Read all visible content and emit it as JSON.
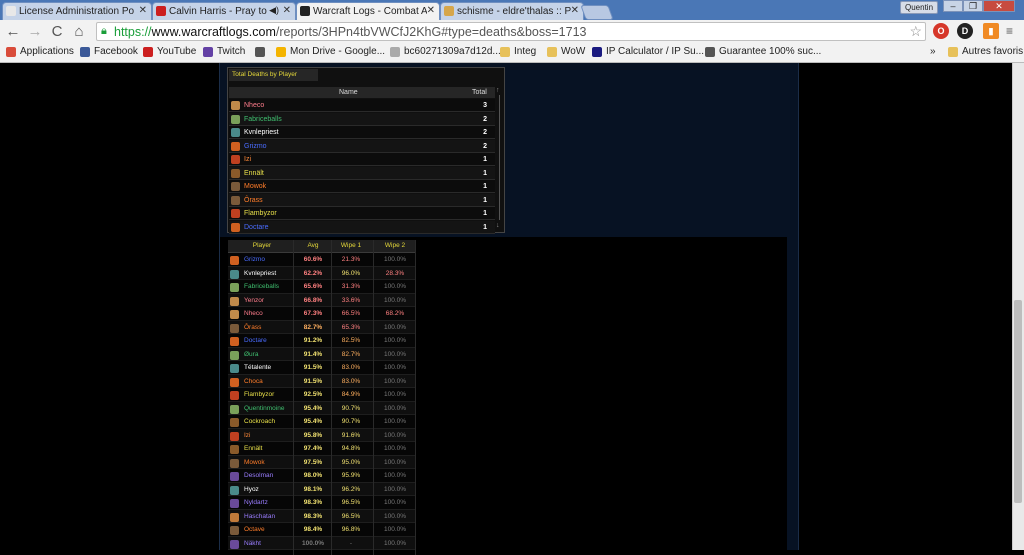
{
  "browser": {
    "tabs": [
      {
        "label": "License Administration Po",
        "favicon_color": "#e8e8e8",
        "favicon_text": "ubnt"
      },
      {
        "label": "Calvin Harris - Pray to",
        "favicon_color": "#cc1f1f",
        "favicon_text": "▶"
      },
      {
        "label": "Warcraft Logs - Combat A",
        "favicon_color": "#222222",
        "favicon_text": "W"
      },
      {
        "label": "schisme - eldre'thalas :: P",
        "favicon_color": "#d6a64a",
        "favicon_text": "✦"
      }
    ],
    "user": "Quentin",
    "window": {
      "minimize": "–",
      "maximize": "❐",
      "close": "✕"
    },
    "url": {
      "scheme": "https://",
      "host": "www.warcraftlogs.com",
      "path": "/reports/3HPn4tbVWCfJ2KhG#type=deaths&boss=1713"
    },
    "nav": {
      "back": "←",
      "forward": "→",
      "reload": "C",
      "home": "⌂",
      "star": "☆",
      "menu": "≡"
    },
    "bookmarks": [
      {
        "label": "Applications",
        "color": "#d94c3a"
      },
      {
        "label": "Facebook",
        "color": "#3b5998"
      },
      {
        "label": "YouTube",
        "color": "#cc1f1f"
      },
      {
        "label": "Twitch",
        "color": "#6441a5"
      },
      {
        "label": "",
        "color": "#555555"
      },
      {
        "label": "Mon Drive - Google...",
        "color": "#f4b400"
      },
      {
        "label": "bc60271309a7d12d...",
        "color": "#aaaaaa"
      },
      {
        "label": "Integ",
        "color": "#e7c15a"
      },
      {
        "label": "WoW",
        "color": "#e7c15a"
      },
      {
        "label": "IP Calculator / IP Su...",
        "color": "#1a1a80"
      },
      {
        "label": "Guarantee 100% suc...",
        "color": "#555555"
      }
    ],
    "bookmarks_more": "»",
    "bookmarks_other": "Autres favoris"
  },
  "deaths_panel": {
    "title": "Total Deaths by Player",
    "col_name": "Name",
    "col_total": "Total",
    "rows": [
      {
        "name": "Nheco",
        "total": "3",
        "color": "#ff7d8c",
        "icon": "#c08a4a"
      },
      {
        "name": "Fabriceballs",
        "total": "2",
        "color": "#3fbf6f",
        "icon": "#7aa15a"
      },
      {
        "name": "Kvnlepriest",
        "total": "2",
        "color": "#ffffff",
        "icon": "#4a8a8a"
      },
      {
        "name": "Grizmo",
        "total": "2",
        "color": "#4a6cff",
        "icon": "#d06020"
      },
      {
        "name": "Izi",
        "total": "1",
        "color": "#ff8a3a",
        "icon": "#c04020"
      },
      {
        "name": "Ennält",
        "total": "1",
        "color": "#e8e04a",
        "icon": "#8a5a2a"
      },
      {
        "name": "Mowok",
        "total": "1",
        "color": "#ff7d2a",
        "icon": "#7a5a3a"
      },
      {
        "name": "Ôrass",
        "total": "1",
        "color": "#ff7d2a",
        "icon": "#7a5a3a"
      },
      {
        "name": "Flambyzor",
        "total": "1",
        "color": "#e8e04a",
        "icon": "#c04020"
      },
      {
        "name": "Doctare",
        "total": "1",
        "color": "#4a6cff",
        "icon": "#d06020"
      }
    ]
  },
  "wipes": {
    "headers": {
      "player": "Player",
      "avg": "Avg",
      "wipe1": "Wipe 1",
      "wipe2": "Wipe 2"
    },
    "rows": [
      {
        "name": "Grizmo",
        "color": "#4a6cff",
        "icon": "#d06020",
        "avg": "60.6%",
        "w1": "21.3%",
        "w2": "100.0%",
        "c1": "#ff8080",
        "c2": "#ff8080",
        "c3": "#7a7a7a"
      },
      {
        "name": "Kvnlepriest",
        "color": "#ffffff",
        "icon": "#4a8a8a",
        "avg": "62.2%",
        "w1": "96.0%",
        "w2": "28.3%",
        "c1": "#ff8080",
        "c2": "#f0e070",
        "c3": "#ff8080"
      },
      {
        "name": "Fabriceballs",
        "color": "#3fbf6f",
        "icon": "#7aa15a",
        "avg": "65.6%",
        "w1": "31.3%",
        "w2": "100.0%",
        "c1": "#ff8080",
        "c2": "#ff8080",
        "c3": "#7a7a7a"
      },
      {
        "name": "Yenzor",
        "color": "#ff7d8c",
        "icon": "#c08a4a",
        "avg": "66.8%",
        "w1": "33.6%",
        "w2": "100.0%",
        "c1": "#ff8080",
        "c2": "#ff8080",
        "c3": "#7a7a7a"
      },
      {
        "name": "Nheco",
        "color": "#ff7d8c",
        "icon": "#c08a4a",
        "avg": "67.3%",
        "w1": "66.5%",
        "w2": "68.2%",
        "c1": "#ff8080",
        "c2": "#ff8080",
        "c3": "#ff8080"
      },
      {
        "name": "Ôrass",
        "color": "#ff7d2a",
        "icon": "#7a5a3a",
        "avg": "82.7%",
        "w1": "65.3%",
        "w2": "100.0%",
        "c1": "#ffb060",
        "c2": "#ff8080",
        "c3": "#7a7a7a"
      },
      {
        "name": "Doctare",
        "color": "#4a6cff",
        "icon": "#d06020",
        "avg": "91.2%",
        "w1": "82.5%",
        "w2": "100.0%",
        "c1": "#f0e070",
        "c2": "#ffb060",
        "c3": "#7a7a7a"
      },
      {
        "name": "Øura",
        "color": "#3fbf6f",
        "icon": "#7aa15a",
        "avg": "91.4%",
        "w1": "82.7%",
        "w2": "100.0%",
        "c1": "#f0e070",
        "c2": "#ffb060",
        "c3": "#7a7a7a"
      },
      {
        "name": "Tétalente",
        "color": "#ffffff",
        "icon": "#4a8a8a",
        "avg": "91.5%",
        "w1": "83.0%",
        "w2": "100.0%",
        "c1": "#f0e070",
        "c2": "#ffb060",
        "c3": "#7a7a7a"
      },
      {
        "name": "Choca",
        "color": "#ff7d2a",
        "icon": "#d06020",
        "avg": "91.5%",
        "w1": "83.0%",
        "w2": "100.0%",
        "c1": "#f0e070",
        "c2": "#ffb060",
        "c3": "#7a7a7a"
      },
      {
        "name": "Flambyzor",
        "color": "#e8e04a",
        "icon": "#c04020",
        "avg": "92.5%",
        "w1": "84.9%",
        "w2": "100.0%",
        "c1": "#f0e070",
        "c2": "#ffb060",
        "c3": "#7a7a7a"
      },
      {
        "name": "Quentinmoine",
        "color": "#3fbf6f",
        "icon": "#7aa15a",
        "avg": "95.4%",
        "w1": "90.7%",
        "w2": "100.0%",
        "c1": "#f0e070",
        "c2": "#f0e070",
        "c3": "#7a7a7a"
      },
      {
        "name": "Cockroach",
        "color": "#e8e04a",
        "icon": "#8a5a2a",
        "avg": "95.4%",
        "w1": "90.7%",
        "w2": "100.0%",
        "c1": "#f0e070",
        "c2": "#f0e070",
        "c3": "#7a7a7a"
      },
      {
        "name": "Izi",
        "color": "#ff8a3a",
        "icon": "#c04020",
        "avg": "95.8%",
        "w1": "91.6%",
        "w2": "100.0%",
        "c1": "#f0e070",
        "c2": "#f0e070",
        "c3": "#7a7a7a"
      },
      {
        "name": "Ennält",
        "color": "#e8e04a",
        "icon": "#8a5a2a",
        "avg": "97.4%",
        "w1": "94.8%",
        "w2": "100.0%",
        "c1": "#f0e070",
        "c2": "#f0e070",
        "c3": "#7a7a7a"
      },
      {
        "name": "Mowok",
        "color": "#ff7d2a",
        "icon": "#7a5a3a",
        "avg": "97.5%",
        "w1": "95.0%",
        "w2": "100.0%",
        "c1": "#f0e070",
        "c2": "#f0e070",
        "c3": "#7a7a7a"
      },
      {
        "name": "Desolman",
        "color": "#9a7dff",
        "icon": "#6a4a9a",
        "avg": "98.0%",
        "w1": "95.9%",
        "w2": "100.0%",
        "c1": "#f0e070",
        "c2": "#f0e070",
        "c3": "#7a7a7a"
      },
      {
        "name": "Hyoz",
        "color": "#ffffff",
        "icon": "#4a8a8a",
        "avg": "98.1%",
        "w1": "96.2%",
        "w2": "100.0%",
        "c1": "#f0e070",
        "c2": "#f0e070",
        "c3": "#7a7a7a"
      },
      {
        "name": "Nyldartz",
        "color": "#9a7dff",
        "icon": "#6a4a9a",
        "avg": "98.3%",
        "w1": "96.5%",
        "w2": "100.0%",
        "c1": "#f0e070",
        "c2": "#f0e070",
        "c3": "#7a7a7a"
      },
      {
        "name": "Haschatan",
        "color": "#9a7dff",
        "icon": "#c07a3a",
        "avg": "98.3%",
        "w1": "96.5%",
        "w2": "100.0%",
        "c1": "#f0e070",
        "c2": "#f0e070",
        "c3": "#7a7a7a"
      },
      {
        "name": "Octave",
        "color": "#ff7d2a",
        "icon": "#7a5a3a",
        "avg": "98.4%",
        "w1": "96.8%",
        "w2": "100.0%",
        "c1": "#f0e070",
        "c2": "#f0e070",
        "c3": "#7a7a7a"
      },
      {
        "name": "Näkht",
        "color": "#9a7dff",
        "icon": "#6a4a9a",
        "avg": "100.0%",
        "w1": "-",
        "w2": "100.0%",
        "c1": "#7a7a7a",
        "c2": "#7a7a7a",
        "c3": "#7a7a7a"
      }
    ]
  }
}
